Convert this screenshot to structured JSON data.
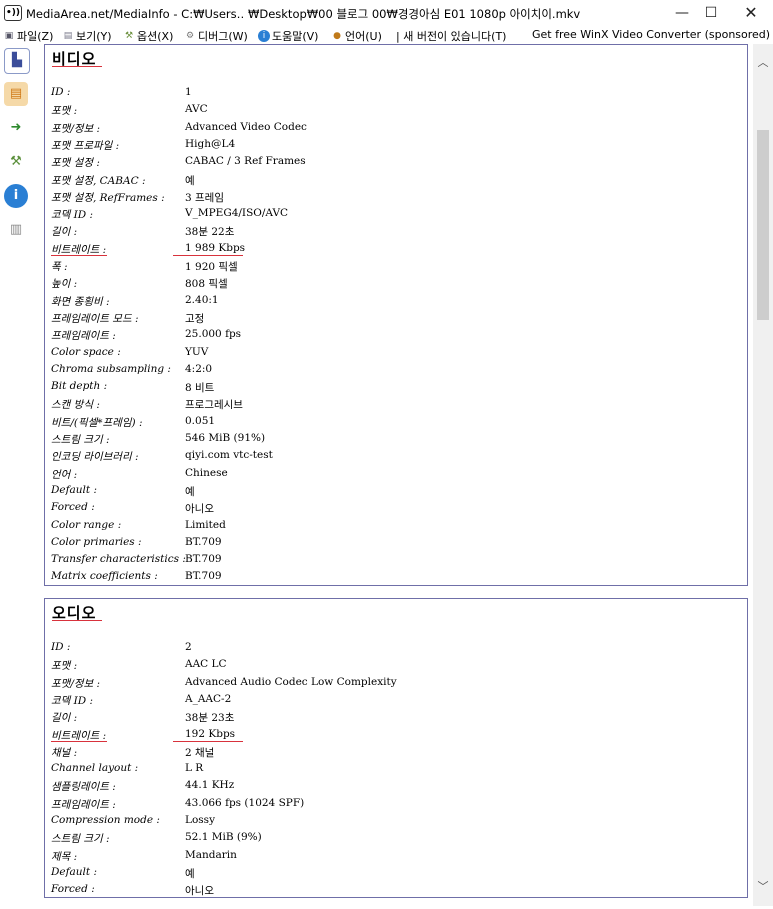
{
  "window": {
    "title": "MediaArea.net/MediaInfo - C:₩Users‥  ₩Desktop₩00 블로그 00₩경경아심 E01 1080p 아이치이.mkv",
    "minimize": "—",
    "maximize": "☐",
    "close": "✕"
  },
  "menu": [
    {
      "label": "파일(Z)",
      "icon": "file-icon"
    },
    {
      "label": "보기(Y)",
      "icon": "view-icon"
    },
    {
      "label": "옵션(X)",
      "icon": "options-icon"
    },
    {
      "label": "디버그(W)",
      "icon": "debug-icon"
    },
    {
      "label": "도움말(V)",
      "icon": "help-icon"
    },
    {
      "label": "언어(U)",
      "icon": "language-icon"
    },
    {
      "label": "| 새 버전이 있습니다(T)",
      "icon": ""
    },
    {
      "label": "Get free WinX Video Converter (sponsored)",
      "icon": ""
    }
  ],
  "video": {
    "title": "비디오",
    "rows": [
      {
        "label": "ID :",
        "value": "1"
      },
      {
        "label": "포맷 :",
        "value": "AVC"
      },
      {
        "label": "포맷/정보 :",
        "value": "Advanced Video Codec"
      },
      {
        "label": "포맷 프로파일 :",
        "value": "High@L4"
      },
      {
        "label": "포맷 설정 :",
        "value": "CABAC / 3 Ref Frames"
      },
      {
        "label": "포맷 설정, CABAC :",
        "value": "예"
      },
      {
        "label": "포맷 설정, RefFrames :",
        "value": "3 프레임"
      },
      {
        "label": "코덱 ID :",
        "value": "V_MPEG4/ISO/AVC"
      },
      {
        "label": "길이 :",
        "value": "38분 22초"
      },
      {
        "label": "비트레이트 :",
        "value": "1 989 Kbps"
      },
      {
        "label": "폭 :",
        "value": "1 920 픽셀"
      },
      {
        "label": "높이 :",
        "value": "808 픽셀"
      },
      {
        "label": "화면 종횡비 :",
        "value": "2.40:1"
      },
      {
        "label": "프레임레이트 모드 :",
        "value": "고정"
      },
      {
        "label": "프레임레이트 :",
        "value": "25.000 fps"
      },
      {
        "label": "Color space :",
        "value": "YUV"
      },
      {
        "label": "Chroma subsampling :",
        "value": "4:2:0"
      },
      {
        "label": "Bit depth :",
        "value": "8 비트"
      },
      {
        "label": "스캔 방식 :",
        "value": "프로그레시브"
      },
      {
        "label": "비트/(픽셀*프레임) :",
        "value": "0.051"
      },
      {
        "label": "스트림 크기 :",
        "value": "546 MiB (91%)"
      },
      {
        "label": "인코딩 라이브러리 :",
        "value": "qiyi.com vtc-test"
      },
      {
        "label": "언어 :",
        "value": "Chinese"
      },
      {
        "label": "Default :",
        "value": "예"
      },
      {
        "label": "Forced :",
        "value": "아니오"
      },
      {
        "label": "Color range :",
        "value": "Limited"
      },
      {
        "label": "Color primaries :",
        "value": "BT.709"
      },
      {
        "label": "Transfer characteristics :",
        "value": "BT.709"
      },
      {
        "label": "Matrix coefficients :",
        "value": "BT.709"
      }
    ]
  },
  "audio": {
    "title": "오디오",
    "rows": [
      {
        "label": "ID :",
        "value": "2"
      },
      {
        "label": "포맷 :",
        "value": "AAC LC"
      },
      {
        "label": "포맷/정보 :",
        "value": "Advanced Audio Codec Low Complexity"
      },
      {
        "label": "코덱 ID :",
        "value": "A_AAC-2"
      },
      {
        "label": "길이 :",
        "value": "38분 23초"
      },
      {
        "label": "비트레이트 :",
        "value": "192 Kbps"
      },
      {
        "label": "채널 :",
        "value": "2 채널"
      },
      {
        "label": "Channel layout :",
        "value": "L R"
      },
      {
        "label": "샘플링레이트 :",
        "value": "44.1 KHz"
      },
      {
        "label": "프레임레이트 :",
        "value": "43.066 fps (1024 SPF)"
      },
      {
        "label": "Compression mode :",
        "value": "Lossy"
      },
      {
        "label": "스트림 크기 :",
        "value": "52.1 MiB (9%)"
      },
      {
        "label": "제목 :",
        "value": "Mandarin"
      },
      {
        "label": "Default :",
        "value": "예"
      },
      {
        "label": "Forced :",
        "value": "아니오"
      }
    ]
  },
  "toolbar": [
    "open-file-icon",
    "open-folder-icon",
    "export-icon",
    "preferences-icon",
    "about-icon",
    "knowledge-base-icon"
  ],
  "scroll": {
    "up": "︿",
    "down": "﹀"
  },
  "colors": {
    "section_border": "#6f6fa8",
    "annotation": "#d8323c"
  }
}
